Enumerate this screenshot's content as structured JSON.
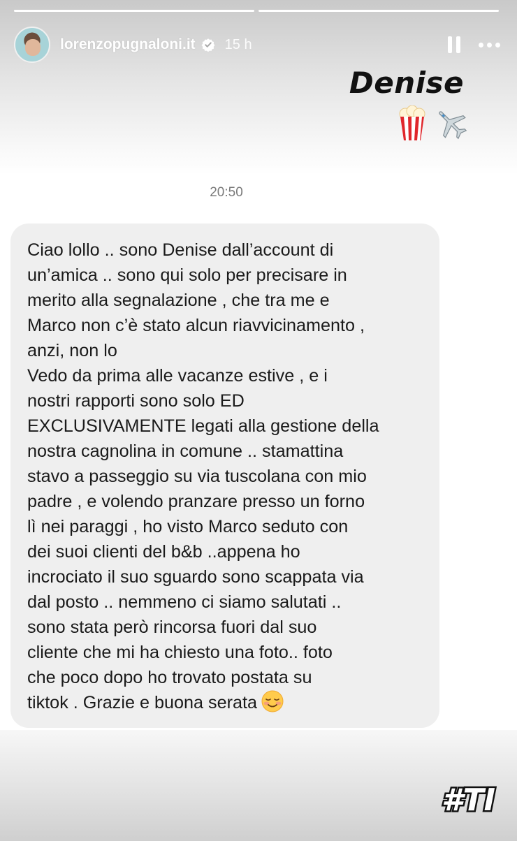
{
  "story": {
    "progress": [
      1.0,
      1.0
    ],
    "username": "lorenzopugnaloni.it",
    "time_ago": "15 h",
    "title": "Denise",
    "emojis": [
      "popcorn",
      "airplane"
    ]
  },
  "message": {
    "timestamp": "20:50",
    "text": "Ciao lollo .. sono Denise dall’account di\nun’amica .. sono qui solo per precisare in\nmerito alla segnalazione , che tra me e\nMarco non c’è stato alcun riavvicinamento ,\nanzi, non lo\nVedo da prima alle vacanze estive , e i\nnostri rapporti sono  solo ED\nEXCLUSIVAMENTE legati alla gestione della\nnostra  cagnolina in comune .. stamattina\nstavo a passeggio su via tuscolana con mio\npadre , e volendo pranzare presso un forno\nlì nei paraggi , ho visto Marco seduto con\ndei suoi clienti del b&b ..appena ho\nincrociato il suo sguardo sono scappata via\ndal posto .. nemmeno ci siamo salutati ..\nsono stata però rincorsa fuori dal suo\ncliente che mi ha chiesto una foto.. foto\nche poco dopo ho trovato postata su\ntiktok . Grazie e buona serata",
    "trailing_emoji": "smiling-face-emoji"
  },
  "watermark": {
    "text": "#TI"
  }
}
